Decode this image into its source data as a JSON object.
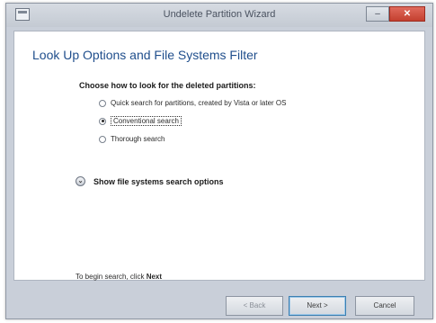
{
  "window": {
    "title": "Undelete Partition Wizard",
    "minimize_label": "–",
    "close_label": "✕"
  },
  "page": {
    "heading": "Look Up Options and File Systems Filter",
    "prompt": "Choose how to look for the deleted partitions:",
    "options": [
      {
        "label": "Quick search for partitions, created by Vista or later OS",
        "checked": false
      },
      {
        "label": "Conventional search",
        "checked": true
      },
      {
        "label": "Thorough search",
        "checked": false
      }
    ],
    "expand_label": "Show file systems search options",
    "hint_prefix": "To begin search, click",
    "hint_action": "Next"
  },
  "footer": {
    "back_label": "< Back",
    "next_label": "Next >",
    "cancel_label": "Cancel"
  },
  "icons": {
    "app": "window-app-icon",
    "expand": "chevron-down-circle-icon"
  },
  "colors": {
    "heading": "#1f4e8c",
    "close_button": "#c4402f",
    "window_frame": "#c9cfd9"
  }
}
